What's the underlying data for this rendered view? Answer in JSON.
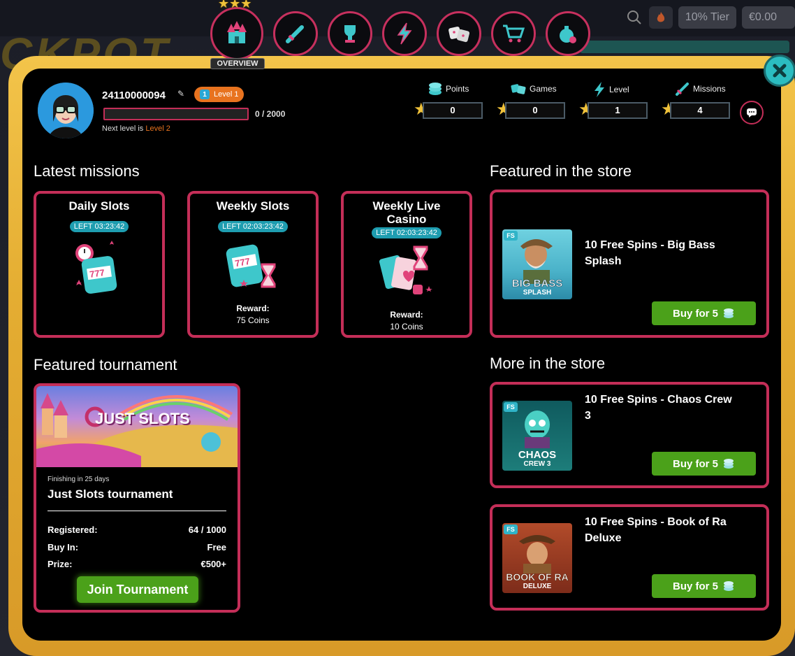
{
  "top_right": {
    "tier_label": "10% Tier",
    "balance": "€0.00"
  },
  "background": {
    "jackpot_text": "CKPOT"
  },
  "nav": {
    "active_label": "OVERVIEW",
    "items": [
      "overview",
      "missions",
      "tournaments",
      "level",
      "games",
      "store",
      "bonuses"
    ]
  },
  "profile": {
    "username": "24110000094",
    "level_badge": "Level 1",
    "level_number": "1",
    "xp_text": "0 / 2000",
    "xp_progress": 0,
    "next_level_prefix": "Next level is ",
    "next_level": "Level 2"
  },
  "stats": [
    {
      "label": "Points",
      "value": "0",
      "icon": "coins-icon"
    },
    {
      "label": "Games",
      "value": "0",
      "icon": "dice-icon"
    },
    {
      "label": "Level",
      "value": "1",
      "icon": "lightning-icon"
    },
    {
      "label": "Missions",
      "value": "4",
      "icon": "sword-icon"
    }
  ],
  "sections": {
    "latest_missions": "Latest missions",
    "featured_store": "Featured in the store",
    "featured_tournament": "Featured tournament",
    "more_store": "More in the store"
  },
  "missions": [
    {
      "title": "Daily Slots",
      "timer": "LEFT 03:23:42",
      "reward_label": "",
      "reward_value": ""
    },
    {
      "title": "Weekly Slots",
      "timer": "LEFT 02:03:23:42",
      "reward_label": "Reward:",
      "reward_value": "75 Coins"
    },
    {
      "title": "Weekly Live Casino",
      "timer": "LEFT 02:03:23:42",
      "reward_label": "Reward:",
      "reward_value": "10 Coins"
    }
  ],
  "featured_store": {
    "title": "10 Free Spins - Big Bass Splash",
    "thumb_text": "BIG BASS",
    "thumb_sub": "SPLASH",
    "tag": "FS",
    "buy_label": "Buy for 5"
  },
  "more_store": [
    {
      "title": "10 Free Spins - Chaos Crew 3",
      "thumb_text": "CHAOS",
      "thumb_sub": "CREW 3",
      "tag": "FS",
      "buy_label": "Buy for 5"
    },
    {
      "title": "10 Free Spins - Book of Ra Deluxe",
      "thumb_text": "BOOK OF RA",
      "thumb_sub": "DELUXE",
      "tag": "FS",
      "buy_label": "Buy for 5"
    }
  ],
  "tournament": {
    "banner_title": "JUST SLOTS",
    "finishing": "Finishing in 25 days",
    "name": "Just Slots tournament",
    "registered_label": "Registered:",
    "registered_value": "64 / 1000",
    "buyin_label": "Buy In:",
    "buyin_value": "Free",
    "prize_label": "Prize:",
    "prize_value": "€500+",
    "join_label": "Join Tournament"
  },
  "colors": {
    "accent_pink": "#c42e58",
    "gold_frame": "#e4ad32",
    "buy_green": "#4ba11a",
    "teal": "#1e9db0",
    "level_orange": "#e8731f"
  }
}
